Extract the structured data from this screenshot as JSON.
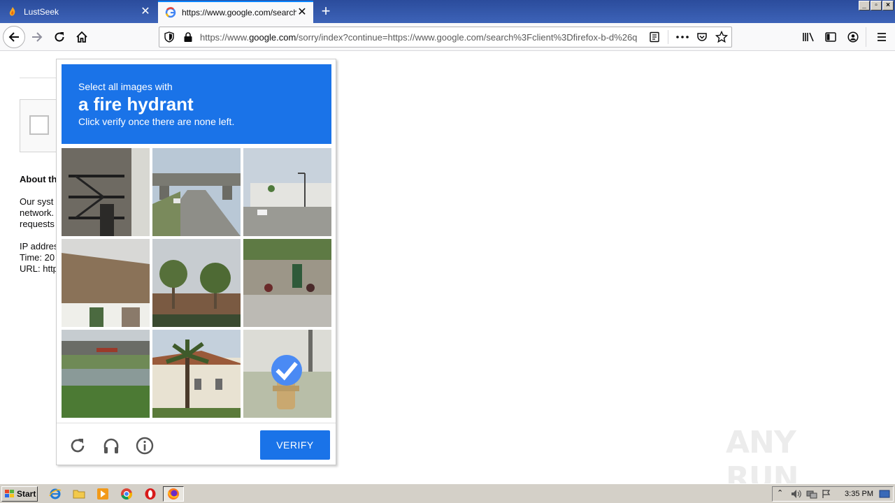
{
  "browser": {
    "tabs": [
      {
        "title": "LustSeek",
        "active": false
      },
      {
        "title": "https://www.google.com/search?c",
        "active": true
      }
    ],
    "url_prefix": "https://www.",
    "url_domain": "google.com",
    "url_rest": "/sorry/index?continue=https://www.google.com/search%3Fclient%3Dfirefox-b-d%26q"
  },
  "page": {
    "about_heading": "About th",
    "lines": [
      "Our syst",
      "network.",
      "requests",
      "",
      "IP addres",
      "Time: 20",
      "URL: http"
    ]
  },
  "captcha": {
    "line1": "Select all images with",
    "target": "a fire hydrant",
    "line3": "Click verify once there are none left.",
    "verify_label": "VERIFY",
    "selected_tile": 9,
    "colors": {
      "accent": "#1a73e8",
      "check": "#4a8af4"
    }
  },
  "watermark": "ANY RUN",
  "taskbar": {
    "start_label": "Start",
    "clock": "3:35 PM"
  }
}
